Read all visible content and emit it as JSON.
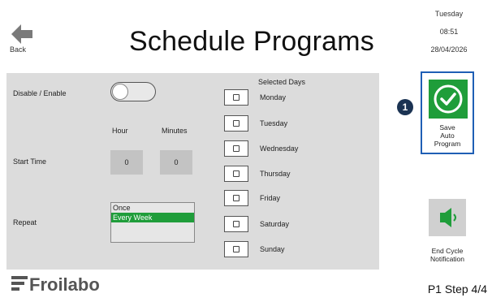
{
  "header": {
    "back_label": "Back",
    "title": "Schedule Programs",
    "day": "Tuesday",
    "time": "08:51",
    "date": "28/04/2026"
  },
  "form": {
    "enable_label": "Disable / Enable",
    "enabled": false,
    "hour_label": "Hour",
    "minutes_label": "Minutes",
    "start_time_label": "Start Time",
    "hour_value": "0",
    "minutes_value": "0",
    "repeat_label": "Repeat",
    "repeat_options": [
      "Once",
      "Every Week"
    ],
    "repeat_selected": "Every Week"
  },
  "days": {
    "title": "Selected Days",
    "items": [
      "Monday",
      "Tuesday",
      "Wednesday",
      "Thursday",
      "Friday",
      "Saturday",
      "Sunday"
    ]
  },
  "actions": {
    "callout_number": "1",
    "save_label_1": "Save",
    "save_label_2": "Auto",
    "save_label_3": "Program",
    "end_label_1": "End Cycle",
    "end_label_2": "Notification"
  },
  "footer": {
    "brand": "Froilabo",
    "step": "P1 Step 4/4"
  },
  "colors": {
    "accent_green": "#1f9d3a",
    "highlight_blue": "#1f5fb5",
    "callout_navy": "#1b3353",
    "panel_gray": "#dcdcdc"
  }
}
